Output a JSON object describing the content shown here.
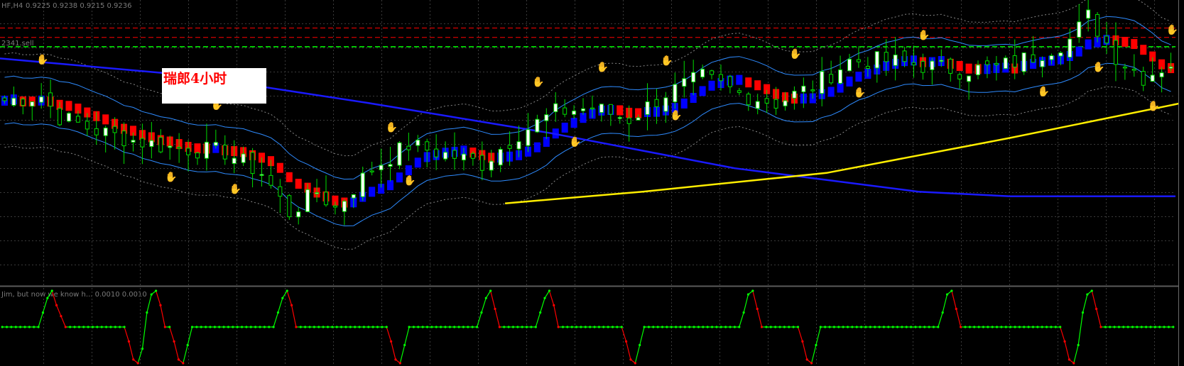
{
  "header": {
    "symbol_text": "HF,H4",
    "quote_text": "0.9225 0.9238 0.9215 0.9236"
  },
  "overlay_label": "瑞郎4小时",
  "level_label": "2341.sell",
  "oscillator_label": "Jim, but now we know h... 0.0010 0.0010",
  "colors": {
    "background": "#000000",
    "grid": "#3a3a3a",
    "bull_candle": "#00dd00",
    "bull_body": "#ffffff",
    "bear_candle": "#00dd00",
    "up_ribbon": "#0000ff",
    "down_ribbon": "#ff0000",
    "slow_ma": "#1a1aff",
    "trend_ma": "#ffee00",
    "channel": "#2e8bff",
    "envelope": "#888888",
    "level_red": "#ff0000",
    "level_green": "#00ff00",
    "hand_top": "#ff3030",
    "hand_bottom": "#3aa8ff",
    "osc_up": "#00ff00",
    "osc_down": "#ff0000"
  },
  "icons": {
    "top_signal": "red-hand-icon",
    "bottom_signal": "blue-hand-icon"
  },
  "chart_data": [
    {
      "type": "candlestick",
      "title": "HF,H4",
      "ylim": [
        0.914,
        0.9262
      ],
      "horizontal_levels": [
        {
          "name": "red-level-1",
          "value": 0.925
        },
        {
          "name": "red-level-2",
          "value": 0.9246
        },
        {
          "name": "2341.sell",
          "value": 0.9242
        }
      ],
      "candles_seed": {
        "count": 128,
        "close_path": [
          [
            0,
            0.9219
          ],
          [
            4,
            0.9221
          ],
          [
            6,
            0.9212
          ],
          [
            10,
            0.9206
          ],
          [
            14,
            0.9202
          ],
          [
            18,
            0.9199
          ],
          [
            24,
            0.9197
          ],
          [
            28,
            0.9188
          ],
          [
            31,
            0.9171
          ],
          [
            34,
            0.918
          ],
          [
            36,
            0.9173
          ],
          [
            40,
            0.919
          ],
          [
            44,
            0.92
          ],
          [
            48,
            0.9196
          ],
          [
            52,
            0.9192
          ],
          [
            56,
            0.9205
          ],
          [
            60,
            0.9214
          ],
          [
            64,
            0.9216
          ],
          [
            68,
            0.9211
          ],
          [
            72,
            0.9222
          ],
          [
            76,
            0.9229
          ],
          [
            80,
            0.9222
          ],
          [
            84,
            0.9218
          ],
          [
            88,
            0.9225
          ],
          [
            92,
            0.9236
          ],
          [
            96,
            0.9236
          ],
          [
            100,
            0.9234
          ],
          [
            104,
            0.9232
          ],
          [
            108,
            0.9233
          ],
          [
            112,
            0.9238
          ],
          [
            116,
            0.9245
          ],
          [
            118,
            0.9255
          ],
          [
            121,
            0.9238
          ],
          [
            124,
            0.9229
          ],
          [
            128,
            0.9237
          ]
        ]
      },
      "hand_signals_top": [
        4,
        28,
        48,
        80,
        102,
        140,
        185,
        205,
        270,
        300
      ],
      "hand_signals_bottom": [
        32,
        40,
        60,
        85,
        100,
        178,
        227,
        290,
        330,
        354
      ],
      "series": [
        {
          "kind": "slow_ma",
          "points": [
            [
              0,
              0.9237
            ],
            [
              20,
              0.923
            ],
            [
              40,
              0.9218
            ],
            [
              60,
              0.9205
            ],
            [
              80,
              0.919
            ],
            [
              100,
              0.918
            ],
            [
              110,
              0.9178
            ],
            [
              128,
              0.9178
            ]
          ]
        },
        {
          "kind": "trend_ma",
          "points": [
            [
              55,
              0.9175
            ],
            [
              70,
              0.918
            ],
            [
              90,
              0.9188
            ],
            [
              110,
              0.9203
            ],
            [
              130,
              0.9219
            ],
            [
              150,
              0.9233
            ],
            [
              170,
              0.9245
            ],
            [
              200,
              0.925
            ]
          ]
        }
      ]
    },
    {
      "type": "line",
      "title": "Jim, but now we know h...",
      "ylim": [
        -100,
        100
      ],
      "values": [
        0,
        0,
        0,
        0,
        0,
        0,
        0,
        0,
        0,
        40,
        80,
        100,
        60,
        30,
        0,
        0,
        0,
        0,
        0,
        0,
        0,
        0,
        0,
        0,
        0,
        0,
        0,
        0,
        -40,
        -90,
        -100,
        -60,
        40,
        90,
        100,
        60,
        0,
        0,
        -40,
        -90,
        -100,
        -50,
        0,
        0,
        0,
        0,
        0,
        0,
        0,
        0,
        0,
        0,
        0,
        0,
        0,
        0,
        0,
        0,
        0,
        0,
        0,
        40,
        80,
        100,
        60,
        0,
        0,
        0,
        0,
        0,
        0,
        0,
        0,
        0,
        0,
        0,
        0,
        0,
        0,
        0,
        0,
        0,
        0,
        0,
        0,
        0,
        -40,
        -90,
        -100,
        -50,
        0,
        0,
        0,
        0,
        0,
        0,
        0,
        0,
        0,
        0,
        0,
        0,
        0,
        0,
        0,
        0,
        40,
        80,
        100,
        50,
        0,
        0,
        0,
        0,
        0,
        0,
        0,
        0,
        0,
        40,
        80,
        100,
        60,
        0,
        0,
        0,
        0,
        0,
        0,
        0,
        0,
        0,
        0,
        0,
        0,
        0,
        0,
        0,
        -40,
        -90,
        -100,
        -50,
        0,
        0,
        0,
        0,
        0,
        0,
        0,
        0,
        0,
        0,
        0,
        0,
        0,
        0,
        0,
        0,
        0,
        0,
        0,
        0,
        0,
        0,
        40,
        90,
        100,
        50,
        0,
        0,
        0,
        0,
        0,
        0,
        0,
        0,
        0,
        -40,
        -90,
        -100,
        -50,
        0,
        0,
        0,
        0,
        0,
        0,
        0,
        0,
        0,
        0,
        0,
        0,
        0,
        0,
        0,
        0,
        0,
        0,
        0,
        0,
        0,
        0,
        0,
        0,
        0,
        0,
        0,
        40,
        90,
        100,
        50,
        0,
        0,
        0,
        0,
        0,
        0,
        0,
        0,
        0,
        0,
        0,
        0,
        0,
        0,
        0,
        0,
        0,
        0,
        0,
        0,
        0,
        0,
        0,
        -40,
        -90,
        -100,
        -50,
        40,
        90,
        100,
        50,
        0,
        0,
        0,
        0,
        0,
        0,
        0,
        0,
        0,
        0,
        0,
        0,
        0,
        0,
        0,
        0,
        0
      ]
    }
  ]
}
